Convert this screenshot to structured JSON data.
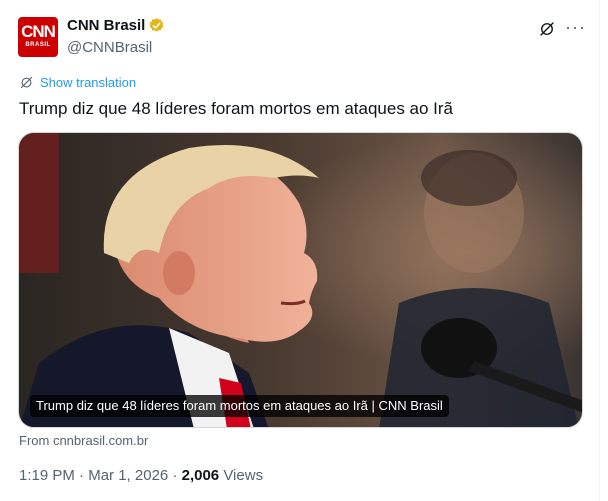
{
  "account": {
    "avatar_logo": "CNN",
    "avatar_sub": "BRASIL",
    "name": "CNN Brasil",
    "handle": "@CNNBrasil",
    "verified_color": "#e2b719"
  },
  "actions": {
    "grok_icon": "grok-icon",
    "more_label": "···"
  },
  "translation": {
    "label": "Show translation",
    "color": "#1d9bf0"
  },
  "tweet": {
    "text": "Trump diz que 48 líderes foram mortos em ataques ao Irã"
  },
  "media": {
    "caption": "Trump diz que 48 líderes foram mortos em ataques ao Irã | CNN Brasil",
    "source": "From cnnbrasil.com.br"
  },
  "meta": {
    "time": "1:19 PM",
    "separator": "·",
    "date": "Mar 1, 2026",
    "views_count": "2,006",
    "views_label": "Views"
  },
  "colors": {
    "brand": "#cc0000",
    "secondary_text": "#536471",
    "primary_text": "#0f1419"
  }
}
